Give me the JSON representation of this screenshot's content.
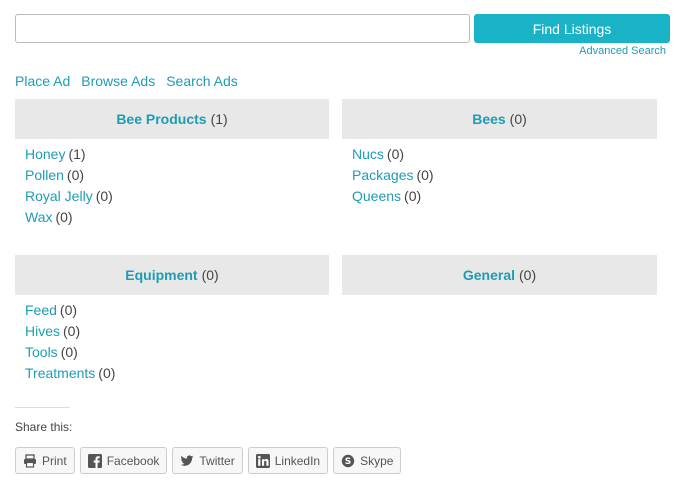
{
  "search": {
    "value": "",
    "placeholder": "",
    "button_label": "Find Listings",
    "advanced_link": "Advanced Search"
  },
  "nav": {
    "place_ad": "Place Ad",
    "browse_ads": "Browse Ads",
    "search_ads": "Search Ads"
  },
  "categories": [
    {
      "name": "Bee Products",
      "count": "(1)",
      "items": [
        {
          "label": "Honey",
          "count": "(1)"
        },
        {
          "label": "Pollen",
          "count": "(0)"
        },
        {
          "label": "Royal Jelly",
          "count": "(0)"
        },
        {
          "label": "Wax",
          "count": "(0)"
        }
      ]
    },
    {
      "name": "Bees",
      "count": "(0)",
      "items": [
        {
          "label": "Nucs",
          "count": "(0)"
        },
        {
          "label": "Packages",
          "count": "(0)"
        },
        {
          "label": "Queens",
          "count": "(0)"
        }
      ]
    },
    {
      "name": "Equipment",
      "count": "(0)",
      "items": [
        {
          "label": "Feed",
          "count": "(0)"
        },
        {
          "label": "Hives",
          "count": "(0)"
        },
        {
          "label": "Tools",
          "count": "(0)"
        },
        {
          "label": "Treatments",
          "count": "(0)"
        }
      ]
    },
    {
      "name": "General",
      "count": "(0)",
      "items": []
    }
  ],
  "share": {
    "title": "Share this:",
    "buttons": [
      {
        "label": "Print",
        "icon": "print-icon"
      },
      {
        "label": "Facebook",
        "icon": "facebook-icon"
      },
      {
        "label": "Twitter",
        "icon": "twitter-icon"
      },
      {
        "label": "LinkedIn",
        "icon": "linkedin-icon"
      },
      {
        "label": "Skype",
        "icon": "skype-icon"
      }
    ]
  },
  "colors": {
    "accent": "#1ab2c6",
    "link": "#1e9cb4",
    "header_bg": "#e8e8e8"
  }
}
